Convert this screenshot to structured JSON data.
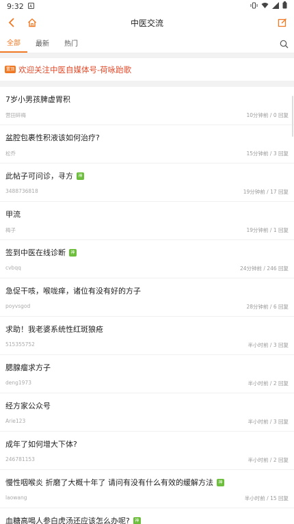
{
  "status_bar": {
    "time": "9:32"
  },
  "header": {
    "title": "中医交流"
  },
  "tabs": [
    {
      "label": "全部"
    },
    {
      "label": "最新"
    },
    {
      "label": "热门"
    }
  ],
  "announcement": {
    "badge": "置顶",
    "text": "欢迎关注中医自媒体号-荷咏跆歌"
  },
  "posts": [
    {
      "title": "7岁小男孩脾虚胃积",
      "author": "营田碎梅",
      "time": "10分钟前",
      "replies": "0 回复",
      "badge": ""
    },
    {
      "title": "盆腔包裹性积液该如何治疗?",
      "author": "松乔",
      "time": "15分钟前",
      "replies": "3 回复",
      "badge": ""
    },
    {
      "title": "此帖子可问诊，寻方",
      "author": "3488736818",
      "time": "19分钟前",
      "replies": "17 回复",
      "badge": "神"
    },
    {
      "title": "甲流",
      "author": "梅子",
      "time": "19分钟前",
      "replies": "1 回复",
      "badge": ""
    },
    {
      "title": "签到中医在线诊断",
      "author": "cvbqq",
      "time": "24分钟前",
      "replies": "246 回复",
      "badge": "神"
    },
    {
      "title": "急促干咳，喉咙痒，诸位有没有好的方子",
      "author": "poyvsgod",
      "time": "28分钟前",
      "replies": "6 回复",
      "badge": ""
    },
    {
      "title": "求助！我老婆系统性红斑狼疮",
      "author": "515355752",
      "time": "半小时前",
      "replies": "3 回复",
      "badge": ""
    },
    {
      "title": "腮腺瘤求方子",
      "author": "deng1973",
      "time": "半小时前",
      "replies": "2 回复",
      "badge": ""
    },
    {
      "title": "经方家公众号",
      "author": "Arie123",
      "time": "半小时前",
      "replies": "3 回复",
      "badge": ""
    },
    {
      "title": "成年了如何增大下体?",
      "author": "246781153",
      "time": "半小时前",
      "replies": "2 回复",
      "badge": ""
    },
    {
      "title": "慢性咽喉炎 折磨了大概十年了 请问有没有什么有效的缓解方法",
      "author": "laowang",
      "time": "半小时前",
      "replies": "15 回复",
      "badge": "神"
    },
    {
      "title": "血糖高喝人参白虎汤还应该怎么办呢?",
      "author": "",
      "time": "",
      "replies": "",
      "badge": "神"
    }
  ]
}
